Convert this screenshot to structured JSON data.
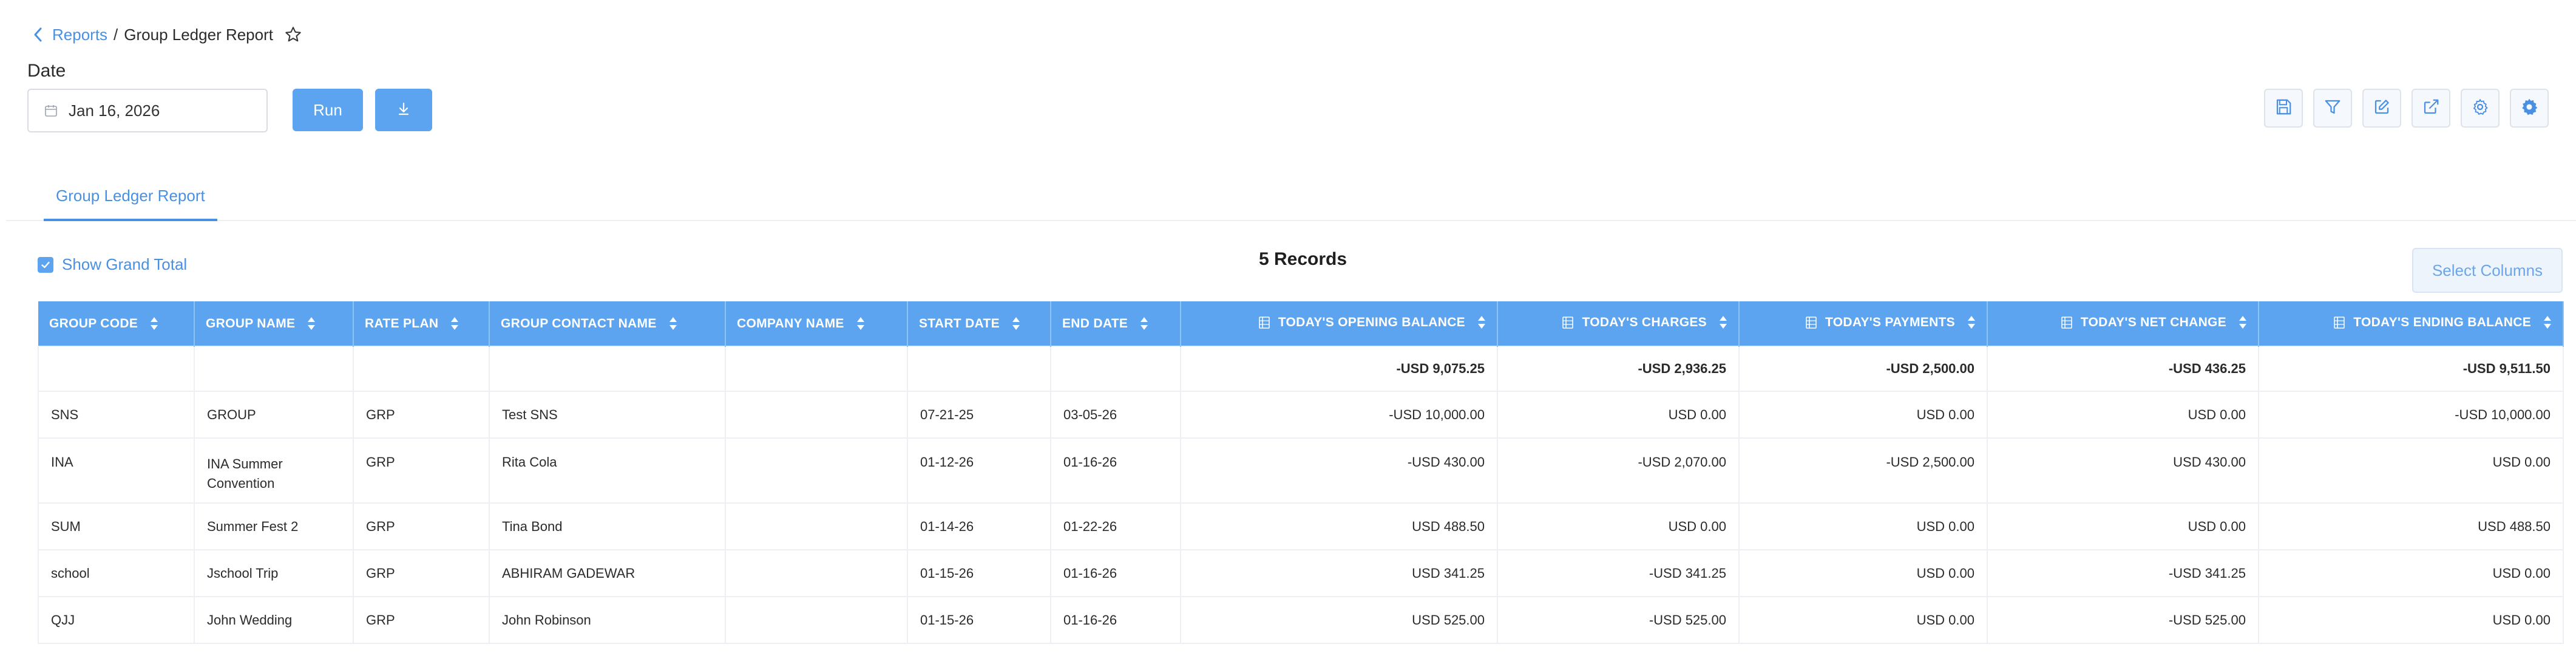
{
  "breadcrumb": {
    "parent": "Reports",
    "separator": "/",
    "current": "Group Ledger Report",
    "back_icon": "chevron-left-icon",
    "star_icon": "star-outline-icon"
  },
  "filters": {
    "date_label": "Date",
    "date_value": "Jan 16, 2026",
    "calendar_icon": "calendar-icon"
  },
  "actions": {
    "run_label": "Run",
    "download_icon": "download-icon"
  },
  "toolbar": [
    "save-icon",
    "filter-icon",
    "edit-icon",
    "external-link-icon",
    "settings-icon",
    "settings-cog-icon"
  ],
  "tabs": [
    {
      "label": "Group Ledger Report",
      "active": true
    }
  ],
  "grand_total": {
    "label": "Show Grand Total",
    "checked": true
  },
  "records_count": "5 Records",
  "select_columns_label": "Select Columns",
  "colors": {
    "accent": "#5ca4f0",
    "link": "#4a90e2",
    "header_text": "#ffffff"
  },
  "table": {
    "columns": [
      "GROUP CODE",
      "GROUP NAME",
      "RATE PLAN",
      "GROUP CONTACT NAME",
      "COMPANY NAME",
      "START DATE",
      "END DATE",
      "TODAY'S OPENING BALANCE",
      "TODAY'S CHARGES",
      "TODAY'S PAYMENTS",
      "TODAY'S NET CHANGE",
      "TODAY'S ENDING BALANCE"
    ],
    "totals": [
      "",
      "",
      "",
      "",
      "",
      "",
      "",
      "-USD 9,075.25",
      "-USD 2,936.25",
      "-USD 2,500.00",
      "-USD 436.25",
      "-USD 9,511.50"
    ],
    "rows": [
      [
        "SNS",
        "GROUP",
        "GRP",
        "Test SNS",
        "",
        "07-21-25",
        "03-05-26",
        "-USD 10,000.00",
        "USD 0.00",
        "USD 0.00",
        "USD 0.00",
        "-USD 10,000.00"
      ],
      [
        "INA",
        "INA Summer Convention",
        "GRP",
        "Rita Cola",
        "",
        "01-12-26",
        "01-16-26",
        "-USD 430.00",
        "-USD 2,070.00",
        "-USD 2,500.00",
        "USD 430.00",
        "USD 0.00"
      ],
      [
        "SUM",
        "Summer Fest 2",
        "GRP",
        "Tina Bond",
        "",
        "01-14-26",
        "01-22-26",
        "USD 488.50",
        "USD 0.00",
        "USD 0.00",
        "USD 0.00",
        "USD 488.50"
      ],
      [
        "school",
        "Jschool Trip",
        "GRP",
        "ABHIRAM GADEWAR",
        "",
        "01-15-26",
        "01-16-26",
        "USD 341.25",
        "-USD 341.25",
        "USD 0.00",
        "-USD 341.25",
        "USD 0.00"
      ],
      [
        "QJJ",
        "John Wedding",
        "GRP",
        "John Robinson",
        "",
        "01-15-26",
        "01-16-26",
        "USD 525.00",
        "-USD 525.00",
        "USD 0.00",
        "-USD 525.00",
        "USD 0.00"
      ]
    ]
  }
}
